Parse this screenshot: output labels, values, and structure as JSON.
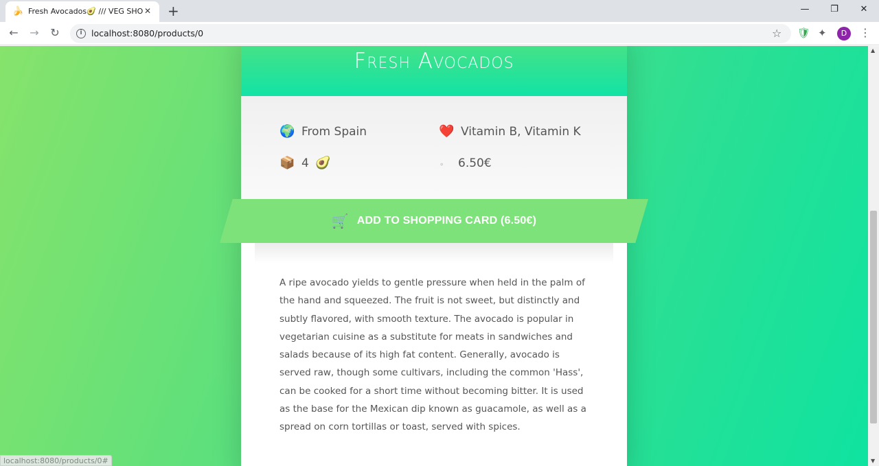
{
  "browser": {
    "tab": {
      "favicon": "🍌",
      "title": "Fresh Avocados🥑 /// VEG SHOP",
      "close": "✕"
    },
    "new_tab": "+",
    "window": {
      "minimize": "—",
      "restore": "❐",
      "close": "✕"
    },
    "nav": {
      "back": "←",
      "forward": "→",
      "reload": "↻"
    },
    "url": "localhost:8080/products/0",
    "info_icon": "i",
    "star": "☆",
    "extensions": {
      "shield": "🛡",
      "puzzle": "✦"
    },
    "avatar_initial": "D",
    "menu": "⋮",
    "status_url": "localhost:8080/products/0#"
  },
  "product": {
    "title": "Fresh Avocados",
    "info": {
      "origin": {
        "icon": "🌍",
        "text": "From Spain"
      },
      "nutrients": {
        "icon": "❤️",
        "text": "Vitamin B, Vitamin K"
      },
      "quantity": {
        "icon": "📦",
        "text": "4",
        "unit_icon": "🥑"
      },
      "price": {
        "icon": "⚬",
        "text": "6.50€"
      }
    },
    "cta": {
      "icon": "🛒",
      "label": "ADD TO SHOPPING CARD (6.50€)"
    },
    "description": "A ripe avocado yields to gentle pressure when held in the palm of the hand and squeezed. The fruit is not sweet, but distinctly and subtly flavored, with smooth texture. The avocado is popular in vegetarian cuisine as a substitute for meats in sandwiches and salads because of its high fat content. Generally, avocado is served raw, though some cultivars, including the common 'Hass', can be cooked for a short time without becoming bitter. It is used as the base for the Mexican dip known as guacamole, as well as a spread on corn tortillas or toast, served with spices."
  },
  "colors": {
    "accent_green": "#7ee27a",
    "header_gradient_top": "#4be283",
    "header_gradient_bottom": "#12e3a6"
  }
}
